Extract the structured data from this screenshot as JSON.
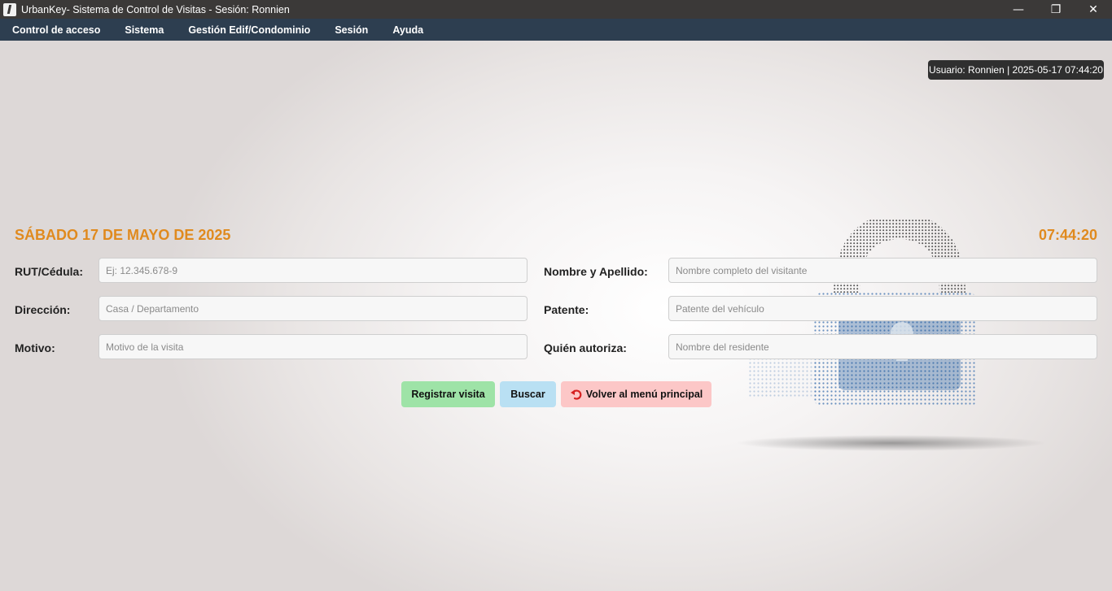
{
  "window": {
    "title": "UrbanKey- Sistema de Control de Visitas - Sesión: Ronnien",
    "controls": {
      "minimize": "—",
      "restore": "❐",
      "close": "✕"
    }
  },
  "menu": {
    "items": [
      "Control de acceso",
      "Sistema",
      "Gestión Edif/Condominio",
      "Sesión",
      "Ayuda"
    ]
  },
  "status": {
    "text": "Usuario: Ronnien | 2025-05-17 07:44:20"
  },
  "header": {
    "date": "SÁBADO 17 DE MAYO DE 2025",
    "time": "07:44:20",
    "accent_color": "#e08a1e"
  },
  "form": {
    "rut": {
      "label": "RUT/Cédula:",
      "placeholder": "Ej: 12.345.678-9",
      "value": ""
    },
    "direccion": {
      "label": "Dirección:",
      "placeholder": "Casa / Departamento",
      "value": ""
    },
    "motivo": {
      "label": "Motivo:",
      "placeholder": "Motivo de la visita",
      "value": ""
    },
    "nombre": {
      "label": "Nombre y Apellido:",
      "placeholder": "Nombre completo del visitante",
      "value": ""
    },
    "patente": {
      "label": "Patente:",
      "placeholder": "Patente del vehículo",
      "value": ""
    },
    "autoriza": {
      "label": "Quién autoriza:",
      "placeholder": "Nombre del residente",
      "value": ""
    }
  },
  "buttons": {
    "register": {
      "label": "Registrar visita",
      "color": "#9ee3a7"
    },
    "search": {
      "label": "Buscar",
      "color": "#b9e0f3"
    },
    "back": {
      "label": "Volver al menú principal",
      "icon": "undo-icon",
      "color": "#fcc7c7"
    }
  },
  "colors": {
    "titlebar": "#3b3938",
    "menubar": "#2d3e50"
  }
}
